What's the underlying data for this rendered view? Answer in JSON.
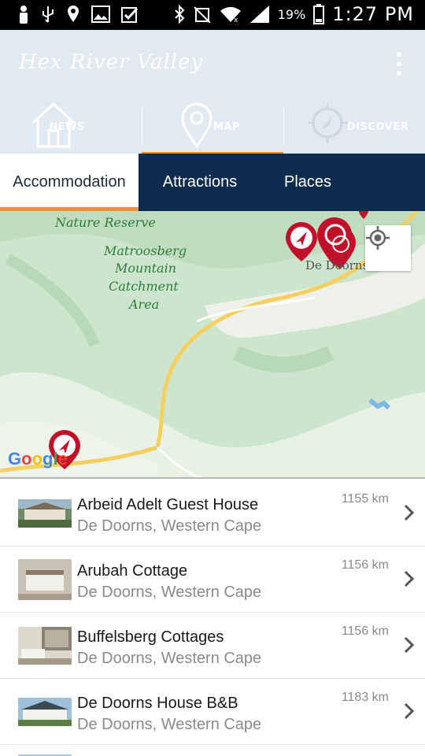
{
  "status": {
    "time": "1:27 PM",
    "battery": "19%",
    "icons": [
      "person-icon",
      "usb-icon",
      "location-icon",
      "image-icon",
      "check-icon",
      "bluetooth-icon",
      "mute-icon",
      "wifi-icon",
      "signal-icon",
      "battery-icon"
    ]
  },
  "app": {
    "title": "Hex River Valley"
  },
  "nav": {
    "tabs": [
      {
        "label": "NEWS",
        "icon": "home-icon"
      },
      {
        "label": "MAP",
        "icon": "map-pin-icon"
      },
      {
        "label": "DISCOVER",
        "icon": "compass-icon"
      }
    ],
    "active": "MAP"
  },
  "subtabs": {
    "items": [
      "Accommodation",
      "Attractions",
      "Places"
    ],
    "active": "Accommodation"
  },
  "map": {
    "labels": [
      "Nature Reserve",
      "Matroosberg",
      "Mountain",
      "Catchment",
      "Area"
    ],
    "town": "De Doorns",
    "google": "Google",
    "colors": {
      "land": "#cfe6cf",
      "road": "#f5d060",
      "marker": "#c0102a"
    }
  },
  "listings": [
    {
      "name": "Arbeid Adelt Guest House",
      "location": "De Doorns, Western Cape",
      "distance": "1155 km"
    },
    {
      "name": "Arubah Cottage",
      "location": "De Doorns, Western Cape",
      "distance": "1156 km"
    },
    {
      "name": "Buffelsberg Cottages",
      "location": "De Doorns, Western Cape",
      "distance": "1156 km"
    },
    {
      "name": "De Doorns House B&B",
      "location": "De Doorns, Western Cape",
      "distance": "1183 km"
    }
  ],
  "colors": {
    "navy": "#0d2b4f",
    "accent": "#e8903a",
    "appbar": "#e1e9f2"
  }
}
